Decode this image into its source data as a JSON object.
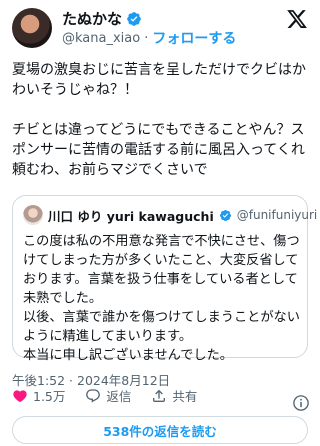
{
  "author": {
    "display_name": "たぬかな",
    "handle": "@kana_xiao",
    "separator": "·",
    "follow_label": "フォローする"
  },
  "tweet": {
    "paragraphs": [
      "夏場の激臭おじに苦言を呈しただけでクビはかわいそうじゃね？！",
      "チビとは違ってどうにでもできることやん？スポンサーに苦情の電話する前に風呂入ってくれ頼むわ、お前らマジでくさいで"
    ]
  },
  "quote": {
    "display_name": "川口 ゆり yuri kawaguchi",
    "handle": "@funifuniyuri",
    "lines": [
      "この度は私の不用意な発言で不快にさせ、傷つけてしまった方が多くいたこと、大変反省しております。言葉を扱う仕事をしている者として未熟でした。",
      "以後、言葉で誰かを傷つけてしまうことがないように精進してまいります。",
      "本当に申し訳ございませんでした。"
    ]
  },
  "timestamp": "午後1:52 · 2024年8月12日",
  "actions": {
    "likes": "1.5万",
    "reply_label": "返信",
    "share_label": "共有"
  },
  "read_replies_label": "538件の返信を読む",
  "colors": {
    "accent": "#1d9bf0",
    "like": "#f91880",
    "muted": "#536471",
    "border": "#cfd9de"
  },
  "icons": [
    "verified-badge-icon",
    "x-logo-icon",
    "heart-icon",
    "reply-icon",
    "share-icon",
    "info-icon"
  ]
}
